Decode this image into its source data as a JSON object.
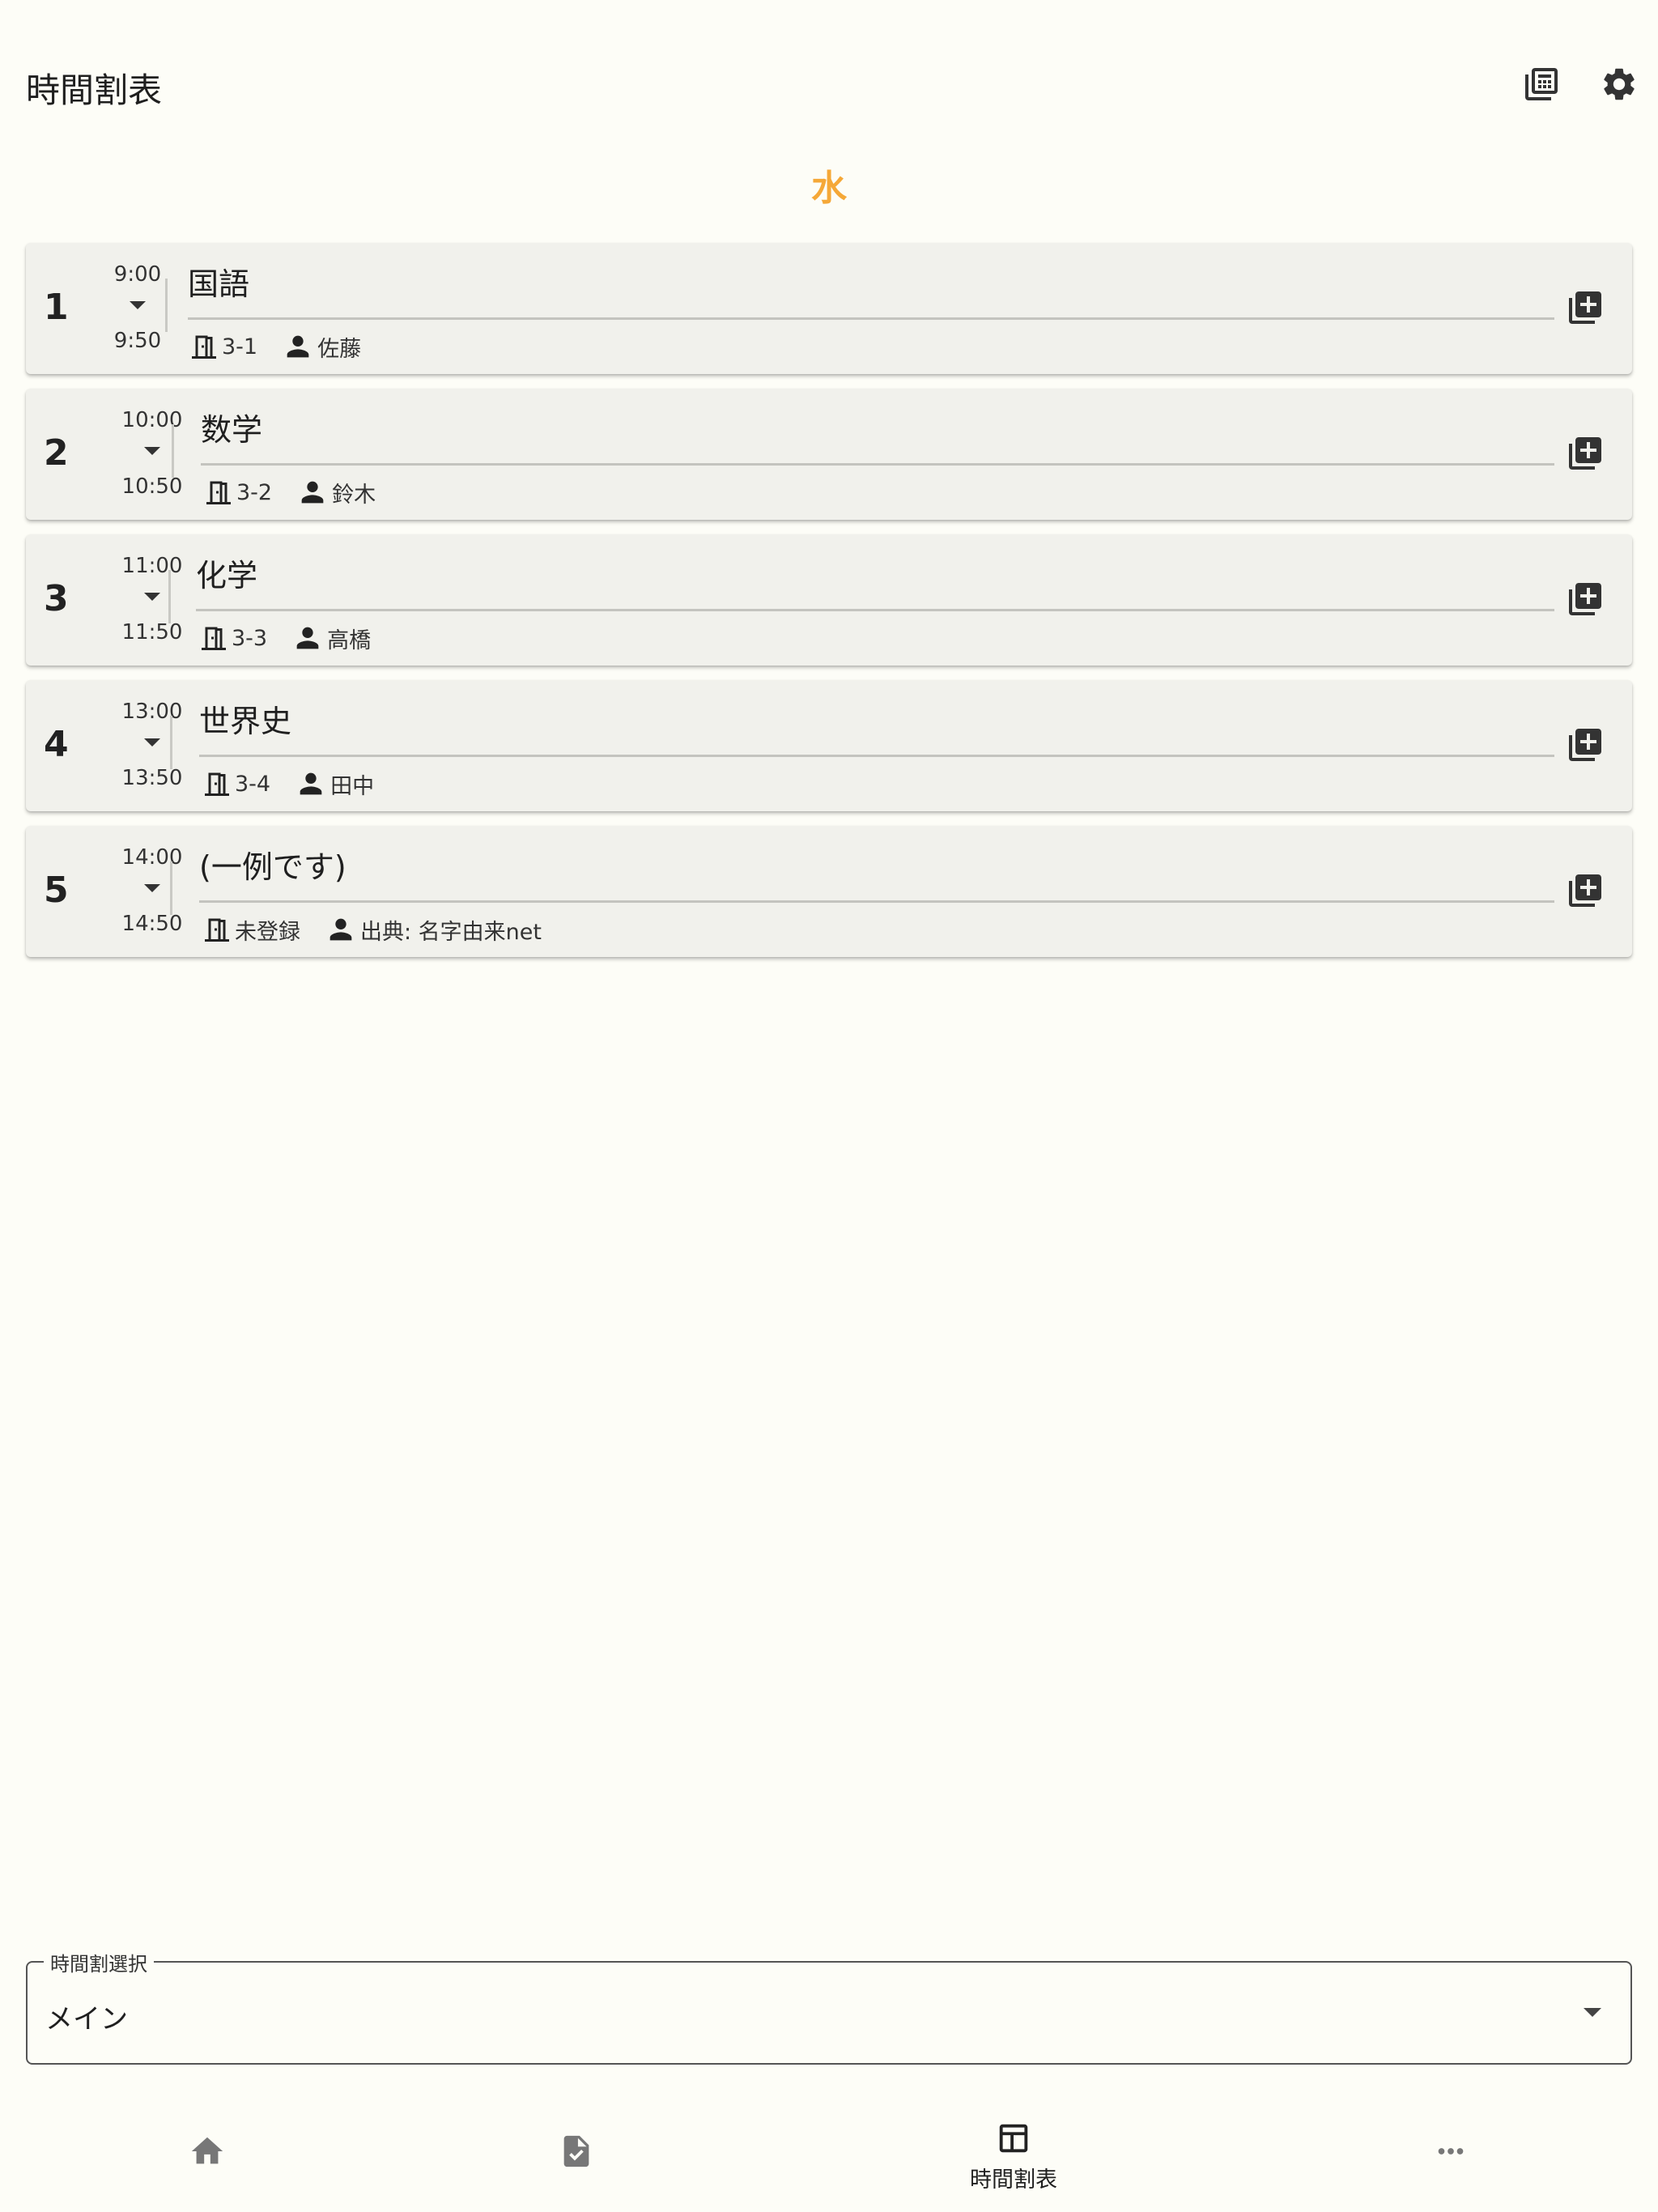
{
  "header": {
    "title": "時間割表",
    "icons": [
      "calculator-icon",
      "gear-icon"
    ]
  },
  "day": "水",
  "periods": [
    {
      "num": "1",
      "start": "9:00",
      "end": "9:50",
      "subject": "国語",
      "room": "3-1",
      "teacher": "佐藤"
    },
    {
      "num": "2",
      "start": "10:00",
      "end": "10:50",
      "subject": "数学",
      "room": "3-2",
      "teacher": "鈴木"
    },
    {
      "num": "3",
      "start": "11:00",
      "end": "11:50",
      "subject": "化学",
      "room": "3-3",
      "teacher": "高橋"
    },
    {
      "num": "4",
      "start": "13:00",
      "end": "13:50",
      "subject": "世界史",
      "room": "3-4",
      "teacher": "田中"
    },
    {
      "num": "5",
      "start": "14:00",
      "end": "14:50",
      "subject": "(一例です)",
      "room": "未登録",
      "teacher": "出典: 名字由来net"
    }
  ],
  "timetable_select": {
    "label": "時間割選択",
    "value": "メイン"
  },
  "nav": {
    "items": [
      {
        "icon": "home-icon",
        "label": ""
      },
      {
        "icon": "task-icon",
        "label": ""
      },
      {
        "icon": "timetable-icon",
        "label": "時間割表",
        "active": true
      },
      {
        "icon": "more-icon",
        "label": ""
      }
    ]
  },
  "colors": {
    "background": "#fdfdf7",
    "card": "#f1f1ec",
    "day_accent": "#f5a838"
  }
}
